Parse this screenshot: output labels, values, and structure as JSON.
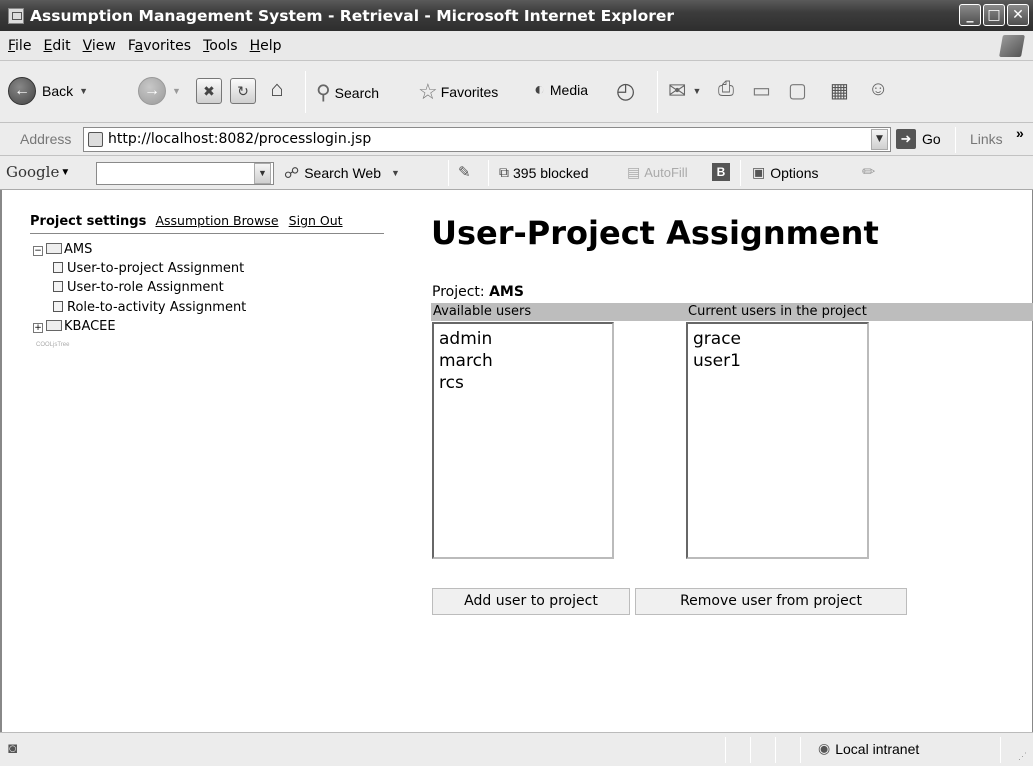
{
  "window": {
    "title": "Assumption Management System - Retrieval - Microsoft Internet Explorer"
  },
  "menu": [
    {
      "label": "File",
      "accel": "F",
      "rest": "ile"
    },
    {
      "label": "Edit",
      "accel": "E",
      "rest": "dit"
    },
    {
      "label": "View",
      "accel": "V",
      "rest": "iew"
    },
    {
      "label": "Favorites",
      "pre": "F",
      "accel": "a",
      "rest": "vorites"
    },
    {
      "label": "Tools",
      "accel": "T",
      "rest": "ools"
    },
    {
      "label": "Help",
      "accel": "H",
      "rest": "elp"
    }
  ],
  "toolbar": {
    "back_label": "Back",
    "search_label": "Search",
    "favorites_label": "Favorites",
    "media_label": "Media"
  },
  "address": {
    "label": "Address",
    "url": "http://localhost:8082/processlogin.jsp",
    "go_label": "Go",
    "links_label": "Links",
    "chevron": "»"
  },
  "googlebar": {
    "logo": "Google",
    "search_web_label": "Search Web",
    "blocked_label": "395 blocked",
    "autofill_label": "AutoFill",
    "options_label": "Options"
  },
  "nav": {
    "project_settings": "Project settings",
    "assumption_browse": "Assumption Browse",
    "sign_out": "Sign Out"
  },
  "tree": {
    "root1": "AMS",
    "children": [
      "User-to-project Assignment",
      "User-to-role Assignment",
      "Role-to-activity Assignment"
    ],
    "root2": "KBACEE",
    "credit": "COOLjsTree"
  },
  "main": {
    "title": "User-Project Assignment",
    "project_label": "Project:",
    "project_name": "AMS",
    "available_header": "Available users",
    "current_header": "Current users in the project",
    "available_users": [
      "admin",
      "march",
      "rcs"
    ],
    "current_users": [
      "grace",
      "user1"
    ],
    "add_button": "Add user to project",
    "remove_button": "Remove user from project"
  },
  "status": {
    "zone_label": "Local intranet"
  }
}
